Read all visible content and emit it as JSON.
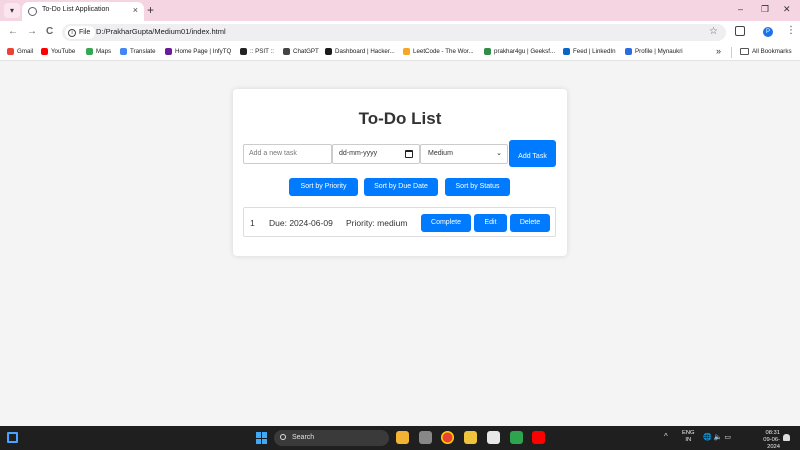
{
  "browser": {
    "tab_title": "To-Do List Application",
    "tab_close": "×",
    "new_tab": "+",
    "window_controls": [
      "–",
      "❐",
      "✕"
    ],
    "nav": {
      "back": "←",
      "forward": "→",
      "reload": "C"
    },
    "file_chip": "File",
    "url": "D:/PrakharGupta/Medium01/index.html",
    "profile_initial": "P",
    "kebab": "⋮",
    "star": "☆",
    "bookmarks": [
      {
        "label": "Gmail",
        "color": "#ea4335"
      },
      {
        "label": "YouTube",
        "color": "#ff0000"
      },
      {
        "label": "Maps",
        "color": "#34a853"
      },
      {
        "label": "Translate",
        "color": "#4285f4"
      },
      {
        "label": "Home Page | InfyTQ",
        "color": "#6a1b9a"
      },
      {
        "label": ":: PSIT ::",
        "color": "#222222"
      },
      {
        "label": "ChatGPT",
        "color": "#444444"
      },
      {
        "label": "Dashboard | Hacker...",
        "color": "#1b1b1b"
      },
      {
        "label": "LeetCode - The Wor...",
        "color": "#f5a623"
      },
      {
        "label": "prakhar4gu | Geeksf...",
        "color": "#2f8d46"
      },
      {
        "label": "Feed | LinkedIn",
        "color": "#0a66c2"
      },
      {
        "label": "Profile | Mynaukri",
        "color": "#2d6cdf"
      }
    ],
    "bookmarks_more": "»",
    "all_bookmarks": "All Bookmarks"
  },
  "app": {
    "title": "To-Do List",
    "task_placeholder": "Add a new task",
    "date_placeholder": "dd-mm-yyyy",
    "priority_selected": "Medium",
    "add_button": "Add Task",
    "sort_buttons": [
      "Sort by Priority",
      "Sort by Due Date",
      "Sort by Status"
    ],
    "tasks": [
      {
        "name": "1",
        "due": "Due: 2024-06-09",
        "priority": "Priority: medium",
        "actions": [
          "Complete",
          "Edit",
          "Delete"
        ]
      }
    ],
    "accent_color": "#007bff"
  },
  "taskbar": {
    "search_label": "Search",
    "language": [
      "ENG",
      "IN"
    ],
    "clock": {
      "time": "08:31",
      "date": "09-06-2024"
    },
    "chevron": "^",
    "system_icons": "🌐 🔈 ▭"
  }
}
